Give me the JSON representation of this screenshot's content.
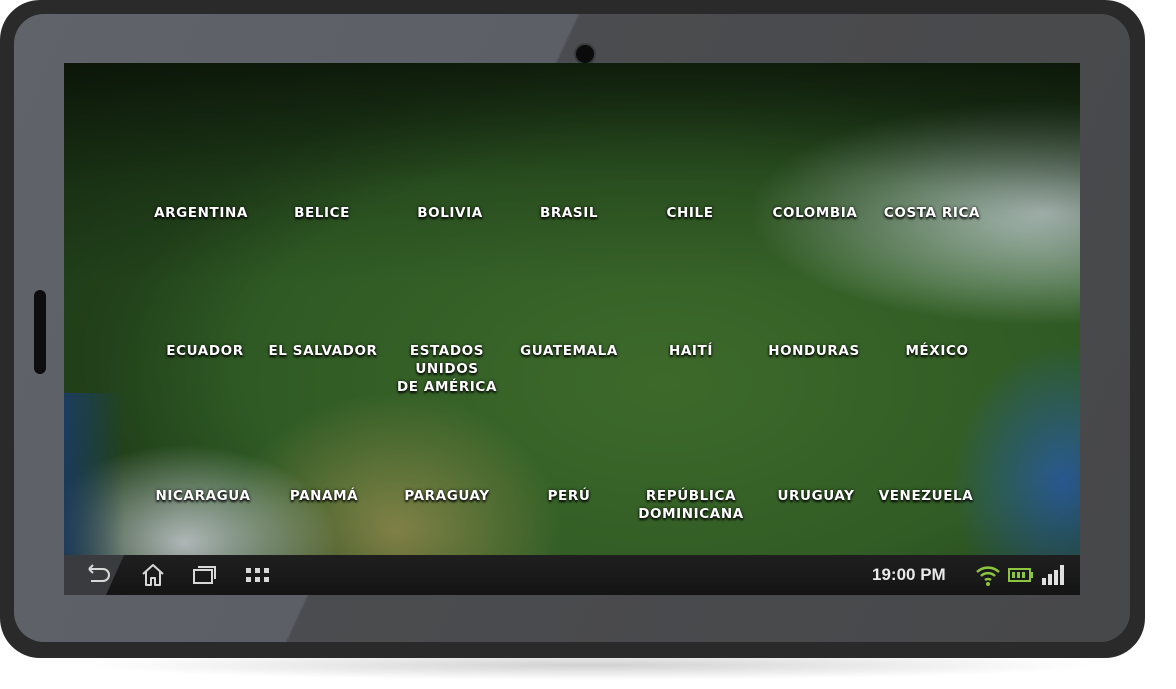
{
  "countries": {
    "r1": [
      "ARGENTINA",
      "BELICE",
      "BOLIVIA",
      "BRASIL",
      "CHILE",
      "COLOMBIA",
      "COSTA RICA"
    ],
    "r2": [
      "ECUADOR",
      "EL SALVADOR",
      "ESTADOS\nUNIDOS\nDE AMÉRICA",
      "GUATEMALA",
      "HAITÍ",
      "HONDURAS",
      "MÉXICO"
    ],
    "r3": [
      "NICARAGUA",
      "PANAMÁ",
      "PARAGUAY",
      "PERÚ",
      "REPÚBLICA\nDOMINICANA",
      "URUGUAY",
      "VENEZUELA"
    ]
  },
  "status_bar": {
    "time": "19:00 PM",
    "icons": [
      "wifi-icon",
      "battery-icon",
      "signal-icon"
    ]
  },
  "nav_bar": {
    "icons": [
      "back-icon",
      "home-icon",
      "recent-apps-icon",
      "apps-grid-icon"
    ]
  },
  "colors": {
    "wifi": "#8cc63f",
    "battery": "#8cc63f",
    "signal": "#e0e0e0",
    "label": "#ffffff"
  }
}
